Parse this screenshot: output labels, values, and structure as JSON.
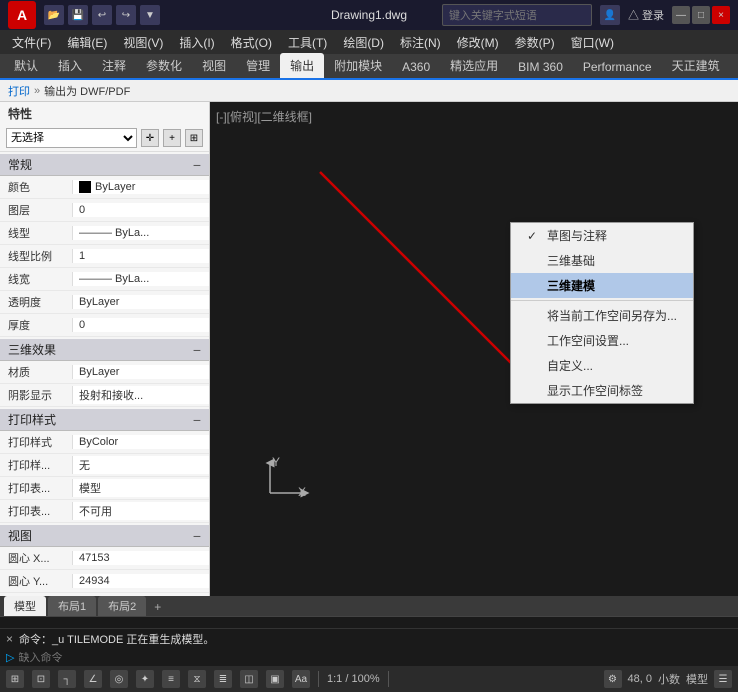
{
  "titlebar": {
    "logo": "A",
    "filename": "Drawing1.dwg",
    "search_placeholder": "键入关键字式短语",
    "user": "△ 登录",
    "window_controls": [
      "—",
      "□",
      "×"
    ]
  },
  "quick_access": [
    "open",
    "save",
    "undo",
    "redo",
    "more"
  ],
  "menu": {
    "items": [
      "文件(F)",
      "编辑(E)",
      "视图(V)",
      "插入(I)",
      "格式(O)",
      "工具(T)",
      "绘图(D)",
      "标注(N)",
      "修改(M)",
      "参数(P)",
      "窗口(W)"
    ]
  },
  "ribbon": {
    "tabs": [
      "默认",
      "插入",
      "注释",
      "参数化",
      "视图",
      "管理",
      "输出",
      "附加模块",
      "A360",
      "精选应用",
      "BIM 360",
      "Performance",
      "天正建筑"
    ]
  },
  "breadcrumb": {
    "items": [
      "打印",
      "输出为 DWF/PDF"
    ]
  },
  "left_panel": {
    "title": "特性",
    "selector_value": "无选择",
    "sections": [
      {
        "name": "常规",
        "properties": [
          {
            "label": "颜色",
            "value": "ByLayer",
            "has_swatch": true
          },
          {
            "label": "图层",
            "value": "0"
          },
          {
            "label": "线型",
            "value": "——— ByLa..."
          },
          {
            "label": "线型比例",
            "value": "1"
          },
          {
            "label": "线宽",
            "value": "——— ByLa..."
          },
          {
            "label": "透明度",
            "value": "ByLayer"
          },
          {
            "label": "厚度",
            "value": "0"
          }
        ]
      },
      {
        "name": "三维效果",
        "properties": [
          {
            "label": "材质",
            "value": "ByLayer"
          },
          {
            "label": "阴影显示",
            "value": "投射和接收..."
          }
        ]
      },
      {
        "name": "打印样式",
        "properties": [
          {
            "label": "打印样式",
            "value": "ByColor"
          },
          {
            "label": "打印样...",
            "value": "无"
          },
          {
            "label": "打印表...",
            "value": "模型"
          },
          {
            "label": "打印表...",
            "value": "不可用"
          }
        ]
      },
      {
        "name": "视图",
        "properties": [
          {
            "label": "圆心 X...",
            "value": "47153"
          },
          {
            "label": "圆心 Y...",
            "value": "24934"
          }
        ]
      }
    ]
  },
  "viewport": {
    "label": "[-][俯视][二维线框]"
  },
  "context_menu": {
    "items": [
      {
        "label": "草图与注释",
        "checked": true,
        "highlighted": false
      },
      {
        "label": "三维基础",
        "checked": false,
        "highlighted": false
      },
      {
        "label": "三维建模",
        "checked": false,
        "highlighted": true
      },
      {
        "label": "将当前工作空间另存为...",
        "checked": false,
        "highlighted": false
      },
      {
        "label": "工作空间设置...",
        "checked": false,
        "highlighted": false
      },
      {
        "label": "自定义...",
        "checked": false,
        "highlighted": false
      },
      {
        "label": "显示工作空间标签",
        "checked": false,
        "highlighted": false
      }
    ]
  },
  "command_bar": {
    "command_text": "命令：_u  TILEMODE  正在重生成模型。",
    "input_placeholder": "缺入命令"
  },
  "status_bar": {
    "coords": "48, 0",
    "mode": "模型",
    "scale": "1:1 / 100%",
    "decimal": "小数",
    "tabs": [
      "模型",
      "布局1",
      "布局2"
    ]
  }
}
